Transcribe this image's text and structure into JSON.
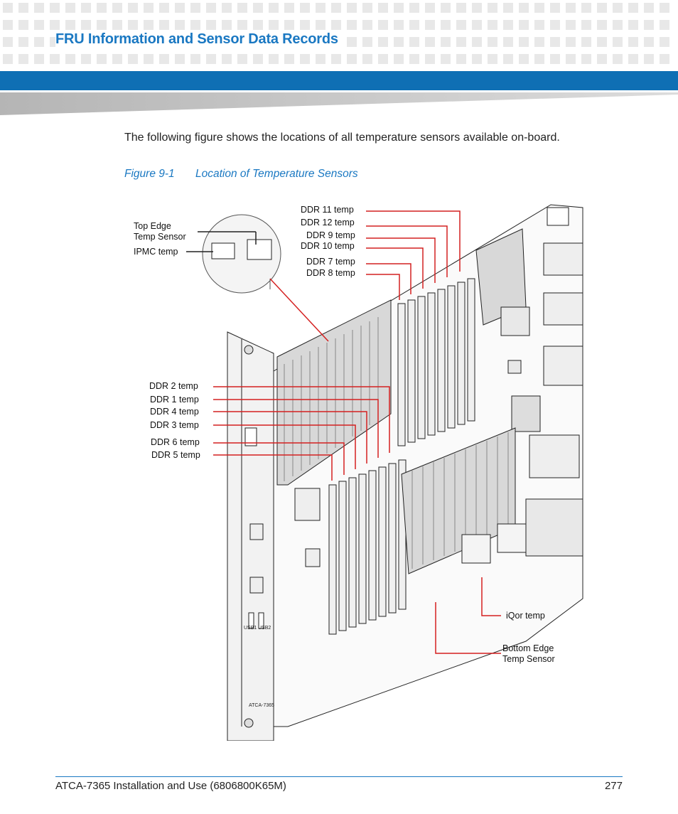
{
  "header": {
    "title": "FRU Information and Sensor Data Records"
  },
  "body": {
    "intro_text": "The following figure shows the locations of all temperature sensors available on-board."
  },
  "figure": {
    "number": "Figure 9-1",
    "caption": "Location of Temperature Sensors",
    "callout_color": "#d42020",
    "labels": {
      "top_edge_line1": "Top Edge",
      "top_edge_line2": "Temp Sensor",
      "ipmc": "IPMC temp",
      "ddr11": "DDR 11 temp",
      "ddr12": "DDR 12 temp",
      "ddr9": "DDR 9 temp",
      "ddr10": "DDR 10 temp",
      "ddr7": "DDR 7 temp",
      "ddr8": "DDR 8 temp",
      "ddr2": "DDR 2 temp",
      "ddr1": "DDR 1 temp",
      "ddr4": "DDR 4 temp",
      "ddr3": "DDR 3 temp",
      "ddr6": "DDR 6 temp",
      "ddr5": "DDR 5 temp",
      "iqor": "iQor temp",
      "bottom_edge_line1": "Bottom Edge",
      "bottom_edge_line2": "Temp Sensor"
    },
    "faceplate_labels": {
      "usb1": "USB1",
      "usb2": "USB2",
      "model": "ATCA-7365"
    }
  },
  "footer": {
    "doc_title": "ATCA-7365 Installation and Use (6806800K65M)",
    "page_number": "277"
  }
}
